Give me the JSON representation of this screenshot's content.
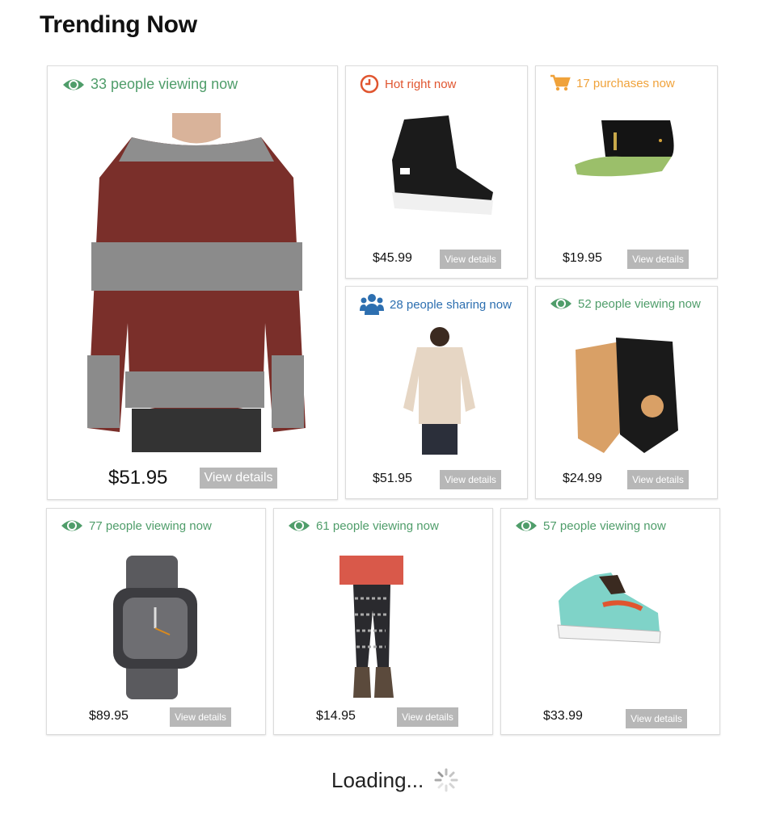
{
  "page": {
    "title": "Trending Now",
    "loading_text": "Loading..."
  },
  "colors": {
    "green": "#4f9d6a",
    "red": "#e0552f",
    "orange": "#f0a23a",
    "blue": "#2d6fb0",
    "button_gray": "#b7b7b7"
  },
  "cards": [
    {
      "badge_icon": "eye-icon",
      "badge_text": "33 people viewing now",
      "product_image": "striped-sweater",
      "price": "$51.95",
      "button": "View details"
    },
    {
      "badge_icon": "clock-icon",
      "badge_text": "Hot right now",
      "product_image": "black-high-top-sneaker",
      "price": "$45.99",
      "button": "View details"
    },
    {
      "badge_icon": "cart-icon",
      "badge_text": "17 purchases now",
      "product_image": "snapback-cap",
      "price": "$19.95",
      "button": "View details"
    },
    {
      "badge_icon": "people-icon",
      "badge_text": "28 people sharing now",
      "product_image": "graphic-top",
      "price": "$51.95",
      "button": "View details"
    },
    {
      "badge_icon": "eye-icon",
      "badge_text": "52 people viewing now",
      "product_image": "gloves",
      "price": "$24.99",
      "button": "View details"
    },
    {
      "badge_icon": "eye-icon",
      "badge_text": "77 people viewing now",
      "product_image": "wrist-watch",
      "price": "$89.95",
      "button": "View details"
    },
    {
      "badge_icon": "eye-icon",
      "badge_text": "61 people viewing now",
      "product_image": "patterned-leggings",
      "price": "$14.95",
      "button": "View details"
    },
    {
      "badge_icon": "eye-icon",
      "badge_text": "57 people viewing now",
      "product_image": "teal-skate-shoe",
      "price": "$33.99",
      "button": "View details"
    }
  ]
}
